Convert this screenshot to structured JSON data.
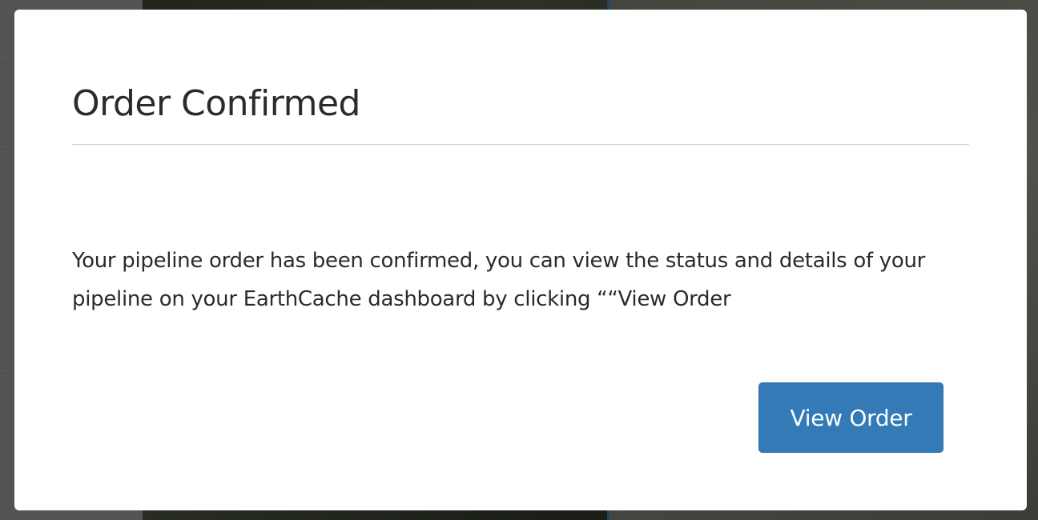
{
  "modal": {
    "title": "Order Confirmed",
    "message": "Your pipeline order has been confirmed, you can view the status and details of your pipeline on your EarthCache dashboard by clicking ““View Order",
    "view_order_label": "View Order"
  },
  "colors": {
    "primary_button": "#337ab7",
    "overlay": "rgba(0,0,0,0.45)",
    "map_divider": "#3a78c0"
  }
}
